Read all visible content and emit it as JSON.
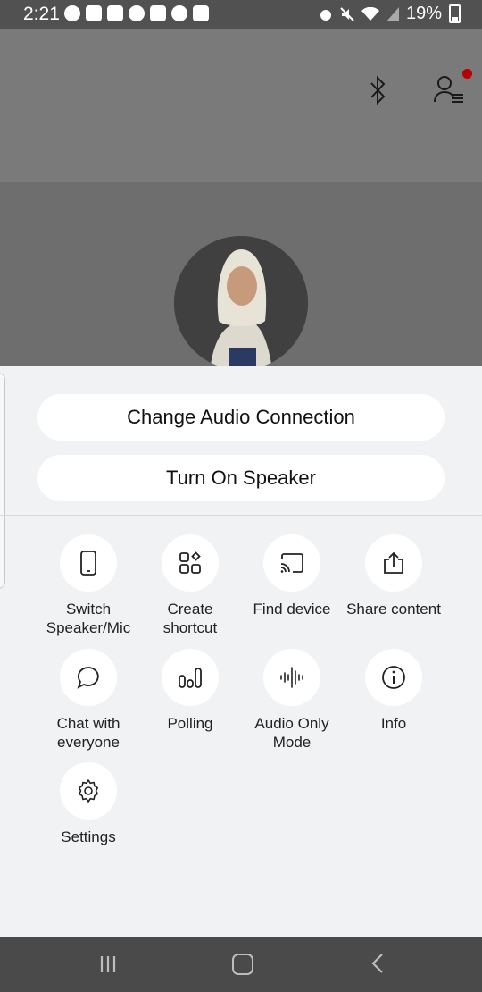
{
  "status_bar": {
    "time": "2:21",
    "battery": "19%",
    "left_icons": [
      "app-icon",
      "m-icon",
      "instagram-icon",
      "circle-app-icon",
      "gallery-icon",
      "circle-app-icon",
      "translate-icon"
    ],
    "right_icons": [
      "alarm-icon",
      "mute-icon",
      "wifi-icon",
      "signal-icon",
      "battery-icon"
    ]
  },
  "meeting": {
    "top_icons": [
      "bluetooth-icon",
      "participants-icon"
    ],
    "notification_color": "#b30000"
  },
  "sheet": {
    "buttons": {
      "change_audio": "Change Audio Connection",
      "turn_on_speaker": "Turn On Speaker"
    },
    "actions": [
      {
        "label": "Switch\nSpeaker/Mic",
        "icon": "phone-icon"
      },
      {
        "label": "Create\nshortcut",
        "icon": "shortcut-icon"
      },
      {
        "label": "Find device",
        "icon": "cast-icon"
      },
      {
        "label": "Share content",
        "icon": "share-icon"
      },
      {
        "label": "Chat with\neveryone",
        "icon": "chat-icon"
      },
      {
        "label": "Polling",
        "icon": "polling-icon"
      },
      {
        "label": "Audio Only\nMode",
        "icon": "audio-wave-icon"
      },
      {
        "label": "Info",
        "icon": "info-icon"
      },
      {
        "label": "Settings",
        "icon": "gear-icon"
      }
    ]
  },
  "nav_bar": {
    "icons": [
      "recent-apps-icon",
      "home-icon",
      "back-icon"
    ]
  }
}
